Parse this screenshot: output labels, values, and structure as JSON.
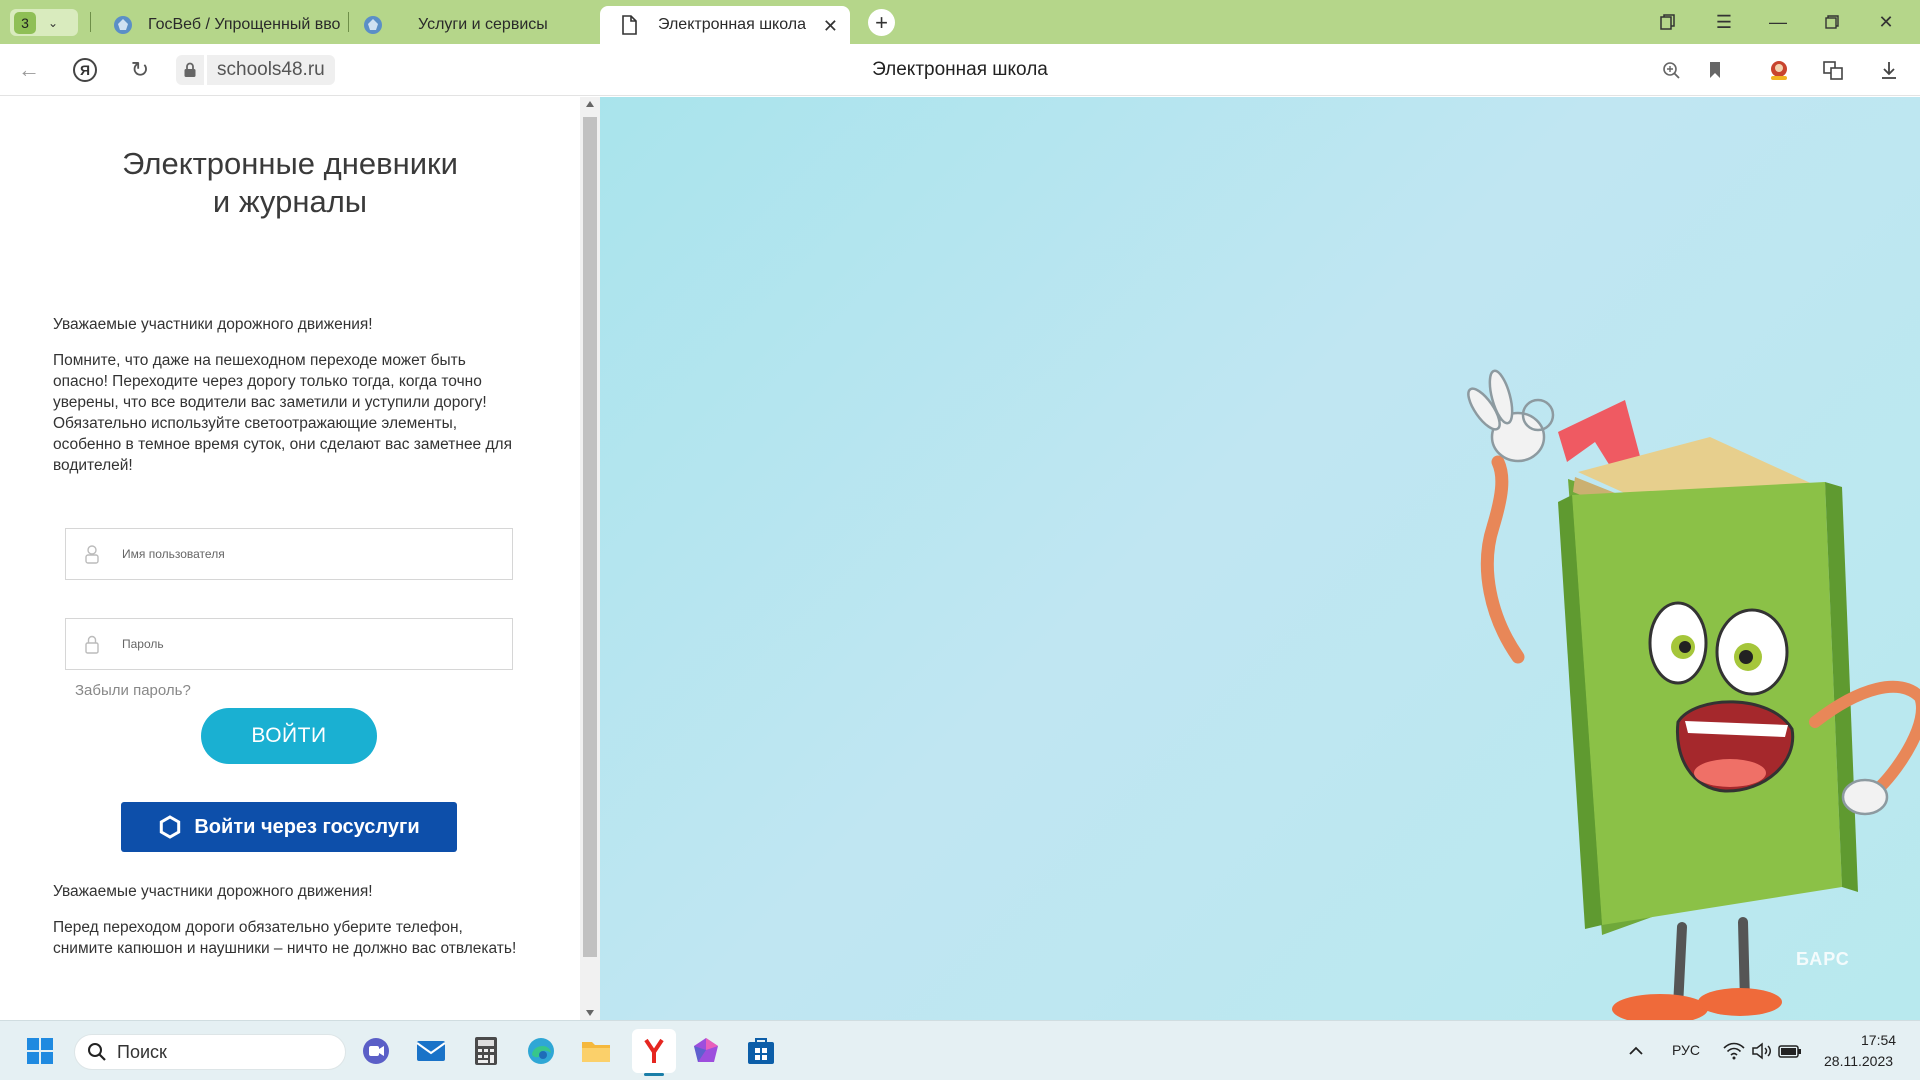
{
  "browser": {
    "tab_count": "3",
    "tabs": [
      {
        "title": "ГосВеб / Упрощенный вво"
      },
      {
        "title": "Услуги и сервисы"
      },
      {
        "title": "Электронная школа"
      }
    ],
    "address": {
      "url": "schools48.ru",
      "page_title": "Электронная школа"
    }
  },
  "page": {
    "title_line1": "Электронные дневники",
    "title_line2": "и журналы",
    "notice1_heading": "Уважаемые участники дорожного движения!",
    "notice1_body": "Помните, что даже на пешеходном переходе может быть опасно! Переходите через дорогу только тогда, когда точно уверены, что все водители вас заметили и уступили дорогу! Обязательно используйте светоотражающие элементы, особенно в темное время суток, они сделают вас заметнее для водителей!",
    "login_form": {
      "username_placeholder": "Имя пользователя",
      "password_placeholder": "Пароль",
      "forgot_password": "Забыли пароль?",
      "login_button": "ВОЙТИ",
      "gosuslugi_button": "Войти через госуслуги"
    },
    "notice2_heading": "Уважаемые участники дорожного движения!",
    "notice2_body": "Перед переходом дороги обязательно уберите телефон, снимите капюшон и наушники – ничто не должно вас отвлекать!",
    "brand_logo": "БАРС"
  },
  "taskbar": {
    "search_placeholder": "Поиск",
    "language": "РУС",
    "time": "17:54",
    "date": "28.11.2023"
  },
  "colors": {
    "tabbar_bg": "#b5d68a",
    "login_button": "#1ab0d2",
    "gosuslugi_button": "#0d4faa",
    "right_panel": "#b8e6ef"
  }
}
